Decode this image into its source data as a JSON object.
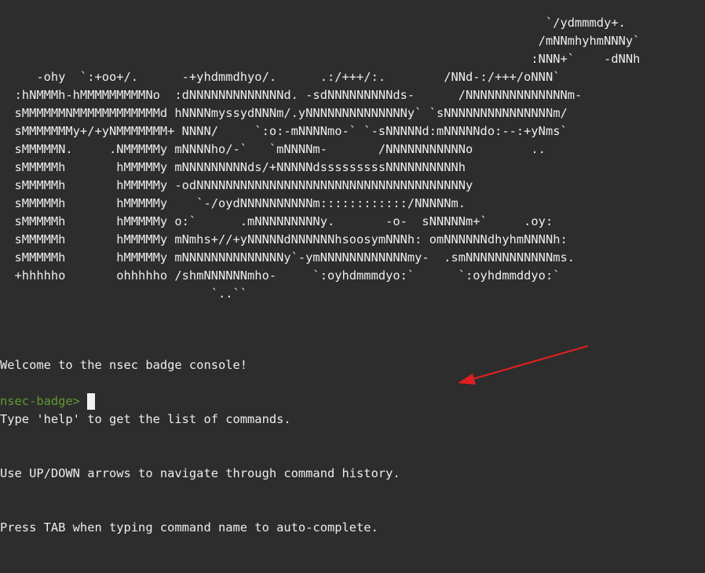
{
  "ascii_logo": [
    "                                                                           `/ydmmmdy+.",
    "                                                                          /mNNmhyhmNNNy`",
    "                                                                         :NNN+`    -dNNh",
    "     -ohy  `:+oo+/.      -+yhdmmdhyo/.      .:/+++/:.        /NNd-:/+++/oNNN`",
    "  :hNMMMh-hMMMMMMMMMNo  :dNNNNNNNNNNNNNd. -sdNNNNNNNNNds-      /NNNNNNNNNNNNNNm-",
    "  sMMMMMMNMMMMMMMMMMMMd hNNNNmyssydNNNm/.yNNNNNNNNNNNNNNy` `sNNNNNNNNNNNNNNNm/",
    "  sMMMMMMMy+/+yNMMMMMMM+ NNNN/     `:o:-mNNNNmo-` `-sNNNNNd:mNNNNNdo:--:+yNms`",
    "  sMMMMMN.     .NMMMMMy mNNNNho/-`   `mNNNNm-       /NNNNNNNNNNNo        ..",
    "  sMMMMMh       hMMMMMy mNNNNNNNNNds/+NNNNNdsssssssssNNNNNNNNNNh",
    "  sMMMMMh       hMMMMMy -odNNNNNNNNNNNNNNNNNNNNNNNNNNNNNNNNNNNNNy",
    "  sMMMMMh       hMMMMMy    `-/oydNNNNNNNNNNm::::::::::::/NNNNNm.",
    "  sMMMMMh       hMMMMMy o:`      .mNNNNNNNNNy.       -o-  sNNNNNm+`     .oy:",
    "  sMMMMMh       hMMMMMy mNmhs+//+yNNNNNdNNNNNNhsoosymNNNh: omNNNNNNdhyhmNNNNh:",
    "  sMMMMMh       hMMMMMy mNNNNNNNNNNNNNNy`-ymNNNNNNNNNNNNmy-  .smNNNNNNNNNNNNms.",
    "  +hhhhho       ohhhhho /shmNNNNNNmho-     `:oyhdmmmdyo:`      `:oyhdmmddyo:`",
    "                             `..``"
  ],
  "welcome_lines": [
    "Welcome to the nsec badge console!",
    "Type 'help' to get the list of commands.",
    "Use UP/DOWN arrows to navigate through command history.",
    "Press TAB when typing command name to auto-complete."
  ],
  "prompt": "nsec-badge>",
  "input_value": "",
  "colors": {
    "background": "#2d2d2d",
    "text": "#ededed",
    "prompt": "#5f9a2f",
    "cursor": "#f2f2f2",
    "annotation_arrow": "#e02020"
  }
}
